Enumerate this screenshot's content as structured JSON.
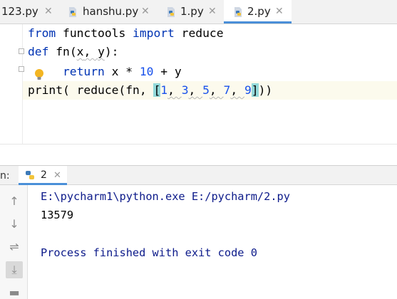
{
  "tabs": [
    {
      "label": "123.py",
      "active": false
    },
    {
      "label": "hanshu.py",
      "active": false
    },
    {
      "label": "1.py",
      "active": false
    },
    {
      "label": "2.py",
      "active": true
    }
  ],
  "editor": {
    "line1": {
      "kw1": "from",
      "t1": " functools ",
      "kw2": "import",
      "t2": " reduce"
    },
    "line2": {
      "kw": "def",
      "t1": " fn(",
      "p1": "x",
      "t2": ", ",
      "p2": "y",
      "t3": "):"
    },
    "line3": {
      "kw": "return",
      "t": " x * ",
      "n": "10",
      "t2": " + y"
    },
    "line4": {
      "t1": "print( reduce(fn, ",
      "b1": "[",
      "n1": "1",
      "c1": ", ",
      "n2": "3",
      "c2": ", ",
      "n3": "5",
      "c3": ", ",
      "n4": "7",
      "c4": ", ",
      "n5": "9",
      "b2": "]",
      "t2": "))"
    }
  },
  "run_panel": {
    "prefix": "n:",
    "tab_label": "2",
    "output": {
      "command": "E:\\pycharm1\\python.exe E:/pycharm/2.py",
      "result": "13579",
      "exit_message": "Process finished with exit code 0"
    }
  },
  "icons": {
    "python_file": "python-file-icon",
    "bulb": "lightbulb-icon",
    "up": "arrow-up-icon",
    "down": "arrow-down-icon",
    "wrap": "soft-wrap-icon",
    "scroll_end": "scroll-to-end-icon",
    "print": "print-icon"
  },
  "colors": {
    "keyword": "#0033b3",
    "number": "#1750eb",
    "console_text": "#0c1a8a",
    "accent": "#4a8fd8"
  }
}
